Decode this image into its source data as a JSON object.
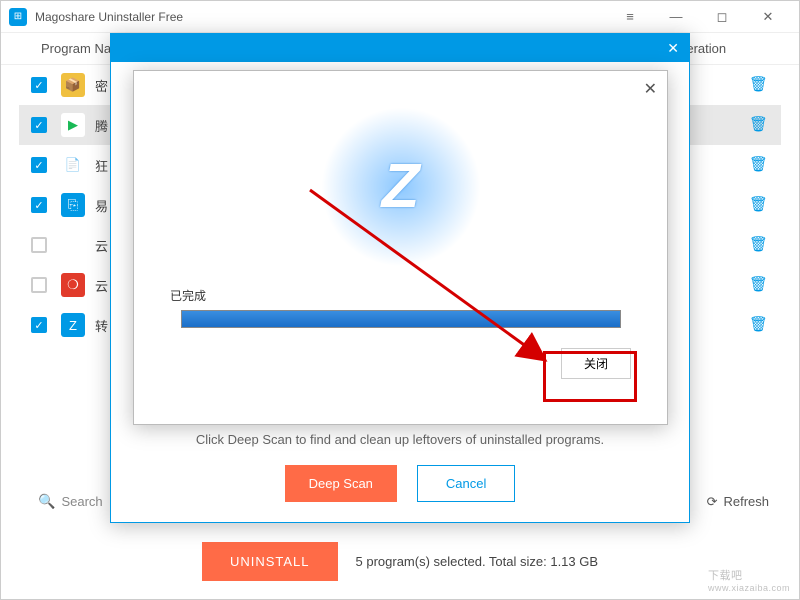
{
  "app": {
    "title": "Magoshare Uninstaller Free"
  },
  "table": {
    "header_name": "Program Na",
    "header_op": "Operation"
  },
  "programs": [
    {
      "checked": true,
      "icon_bg": "#f0c040",
      "icon_text": "📦",
      "label": "密",
      "highlight": false
    },
    {
      "checked": true,
      "icon_bg": "#ffffff",
      "icon_text": "▶",
      "icon_fg": "#19b955",
      "label": "腾",
      "highlight": true
    },
    {
      "checked": true,
      "icon_bg": "#ffffff",
      "icon_text": "📄",
      "label": "狂",
      "highlight": false
    },
    {
      "checked": true,
      "icon_bg": "#0099e5",
      "icon_text": "⎘",
      "label": "易",
      "highlight": false
    },
    {
      "checked": false,
      "icon_bg": "#ffffff",
      "icon_text": "🖥",
      "label": "云 f",
      "highlight": false
    },
    {
      "checked": false,
      "icon_bg": "#e13b2b",
      "icon_text": "❍",
      "label": "云 f",
      "highlight": false
    },
    {
      "checked": true,
      "icon_bg": "#0099e5",
      "icon_text": "Z",
      "label": "转",
      "highlight": false
    }
  ],
  "search": {
    "placeholder": "Search"
  },
  "refresh": {
    "label": "Refresh"
  },
  "uninstall": {
    "button": "UNINSTALL",
    "status": "5 program(s) selected. Total size: 1.13 GB"
  },
  "dialog1": {
    "hint": "Click Deep Scan to find and clean up leftovers of uninstalled programs.",
    "deep_scan": "Deep Scan",
    "cancel": "Cancel"
  },
  "dialog2": {
    "status": "已完成",
    "progress_pct": 100,
    "close": "关闭"
  },
  "watermark": {
    "line1": "下载吧",
    "line2": "www.xiazaiba.com"
  }
}
